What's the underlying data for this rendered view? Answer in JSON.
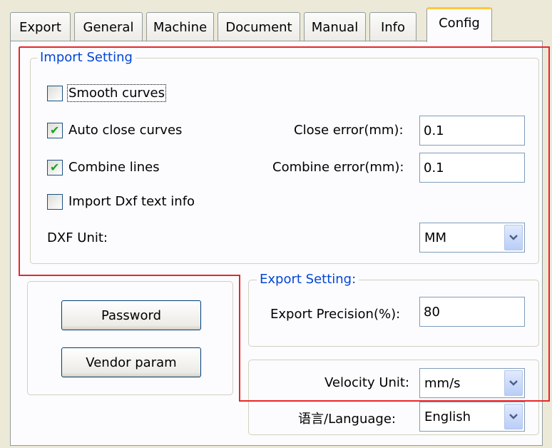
{
  "tabs": [
    {
      "label": "Export",
      "active": false
    },
    {
      "label": "General",
      "active": false
    },
    {
      "label": "Machine",
      "active": false
    },
    {
      "label": "Document",
      "active": false
    },
    {
      "label": "Manual",
      "active": false
    },
    {
      "label": "Info",
      "active": false
    },
    {
      "label": "Config",
      "active": true
    }
  ],
  "import_setting": {
    "title": "Import Setting",
    "smooth_curves": {
      "label": "Smooth curves",
      "checked": false
    },
    "auto_close_curves": {
      "label": "Auto close curves",
      "checked": true
    },
    "combine_lines": {
      "label": "Combine lines",
      "checked": true
    },
    "import_dxf_text": {
      "label": "Import Dxf text info",
      "checked": false
    },
    "close_error_label": "Close error(mm):",
    "close_error_value": "0.1",
    "combine_error_label": "Combine error(mm):",
    "combine_error_value": "0.1",
    "dxf_unit_label": "DXF Unit:",
    "dxf_unit_value": "MM"
  },
  "buttons": {
    "password": "Password",
    "vendor_param": "Vendor param"
  },
  "export_setting": {
    "title": "Export Setting:",
    "precision_label": "Export Precision(%):",
    "precision_value": "80"
  },
  "misc_setting": {
    "velocity_unit_label": "Velocity Unit:",
    "velocity_unit_value": "mm/s",
    "language_label": "语言/Language:",
    "language_value": "English"
  },
  "colors": {
    "group_title": "#0046d5",
    "highlight_outline": "#e8262a",
    "checkmark": "#21a121",
    "active_tab_accent": "#ffc83c"
  },
  "icons": {
    "checkmark": "check-icon",
    "combo_arrow": "chevron-down-icon"
  }
}
